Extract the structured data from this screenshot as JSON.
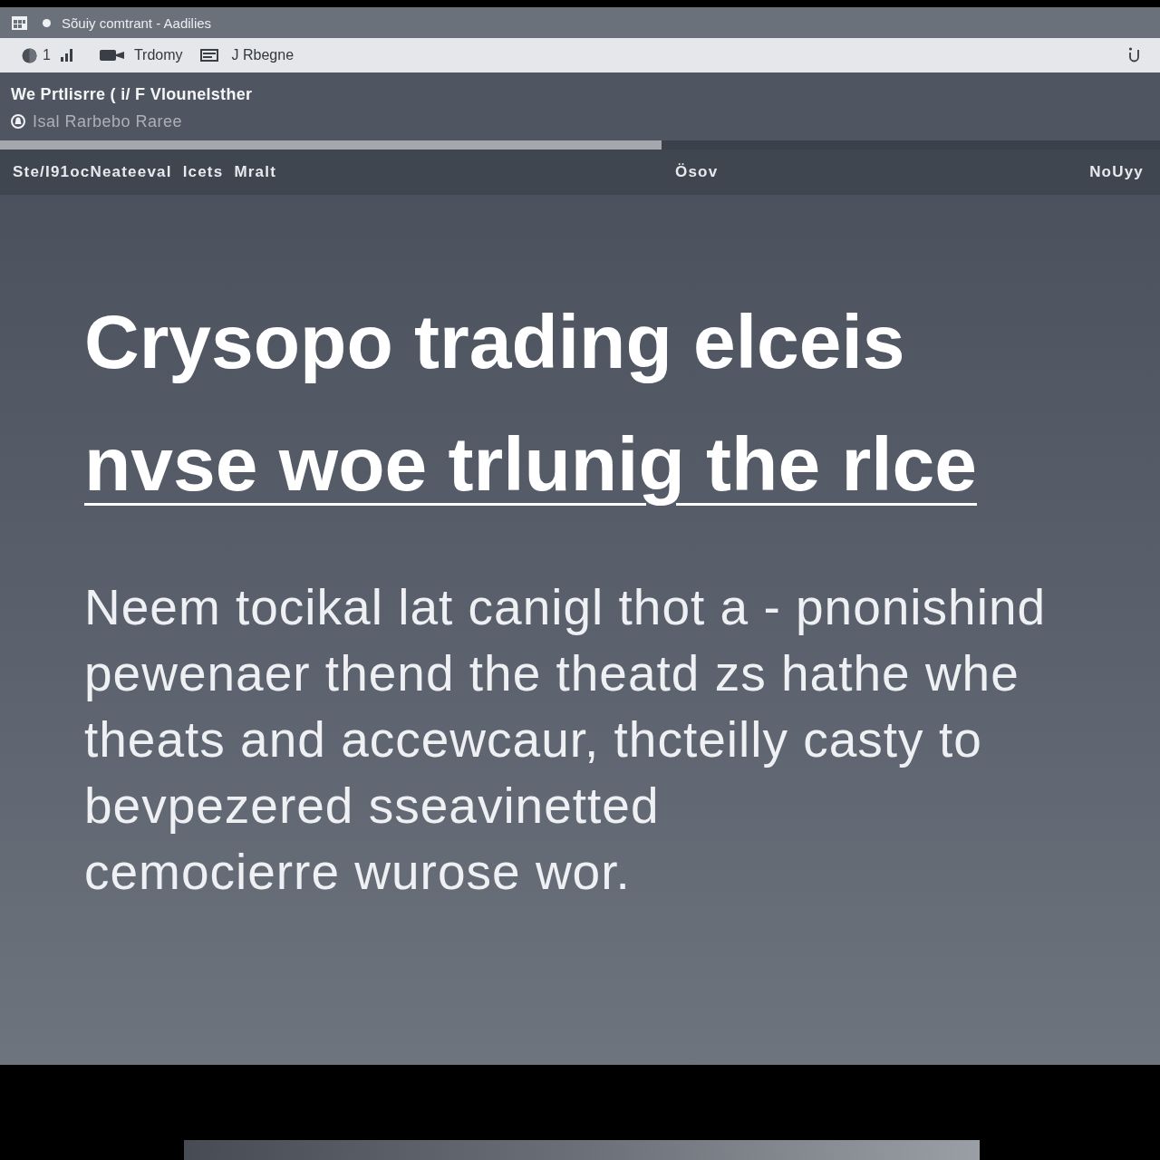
{
  "window": {
    "title": "Sõuiy comtrant - Aadilies"
  },
  "toolbar": {
    "count": "1",
    "links": [
      "Trdomy",
      "J Rbegne"
    ]
  },
  "header": {
    "title": "We Prtlisrre ( i/ F Vlounelsther",
    "subtitle": "Isal Rarbebo Raree",
    "progress": {
      "level": 0.57
    }
  },
  "nav": {
    "items": [
      "Ste/I91ocNeateeval",
      "lcets",
      "Mralt"
    ],
    "center": "Ösov",
    "right": "NoUyy"
  },
  "main": {
    "headline": "Crysopo trading elceis",
    "headline_link": "nvse woe trlunig the rlce",
    "body_lines": [
      "Neem tocikal lat canigl thot a - pnonishind",
      "pewenaer thend the theatd zs hathe whe",
      "theats and accewcaur, thcteilly casty to",
      "bevpezered sseavinetted",
      "cemocierre wurose wor."
    ]
  }
}
